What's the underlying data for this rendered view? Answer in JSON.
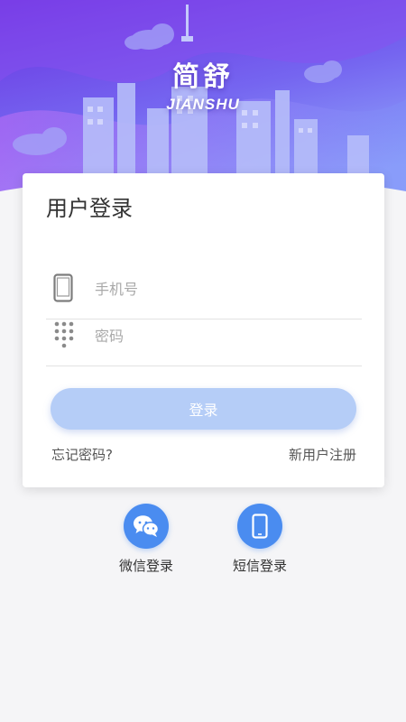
{
  "brand": {
    "name_cn": "简舒",
    "name_en": "JIANSHU"
  },
  "login_card": {
    "title": "用户登录",
    "phone_placeholder": "手机号",
    "password_placeholder": "密码",
    "login_button": "登录",
    "forgot_password": "忘记密码?",
    "register": "新用户注册"
  },
  "third_party": [
    {
      "label": "微信登录",
      "icon": "wechat-icon"
    },
    {
      "label": "短信登录",
      "icon": "smartphone-icon"
    }
  ],
  "colors": {
    "hero_top": "#6a3ee0",
    "hero_bottom": "#8a8cf8",
    "login_button": "#b5cdf7",
    "accent": "#4a8cf0"
  }
}
